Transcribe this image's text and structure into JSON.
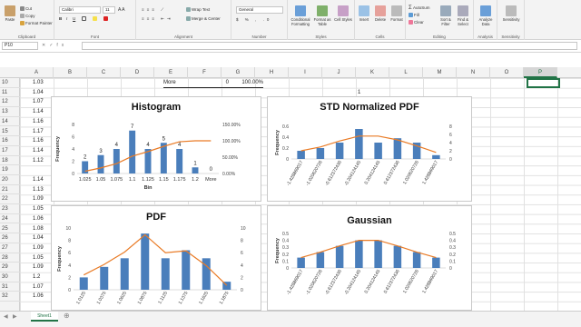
{
  "ribbon": {
    "clipboard": {
      "cut": "Cut",
      "copy": "Copy",
      "format_painter": "Format Painter",
      "paste": "Paste",
      "label": "Clipboard"
    },
    "font": {
      "name": "Calibri",
      "size": "11",
      "label": "Font",
      "bold": "B",
      "italic": "I",
      "underline": "U"
    },
    "alignment": {
      "wrap": "Wrap Text",
      "merge": "Merge & Center",
      "label": "Alignment"
    },
    "number": {
      "format": "General",
      "label": "Number",
      "pct": "%",
      "comma": ","
    },
    "styles": {
      "cond": "Conditional Formatting",
      "table": "Format as Table",
      "cell": "Cell Styles",
      "label": "Styles"
    },
    "cells": {
      "insert": "Insert",
      "delete": "Delete",
      "format": "Format",
      "label": "Cells"
    },
    "editing": {
      "autosum": "AutoSum",
      "fill": "Fill",
      "clear": "Clear",
      "sort": "Sort & Filter",
      "find": "Find & Select",
      "label": "Editing"
    },
    "analysis": {
      "analyze": "Analyze Data",
      "label": "Analysis"
    },
    "sensitivity": {
      "btn": "Sensitivity",
      "label": "Sensitivity"
    }
  },
  "formula_bar": {
    "name_box": "P10",
    "formula": ""
  },
  "columns": [
    "A",
    "B",
    "C",
    "D",
    "E",
    "F",
    "G",
    "H",
    "I",
    "J",
    "K",
    "L",
    "M",
    "N",
    "O",
    "P"
  ],
  "selected_column": "P",
  "rows": [
    "10",
    "11",
    "12",
    "13",
    "14",
    "15",
    "16",
    "17",
    "18",
    "19",
    "20",
    "21",
    "22",
    "23",
    "24",
    "25",
    "26",
    "27",
    "28",
    "29",
    "30",
    "31",
    "32"
  ],
  "col_a_values": [
    "1.03",
    "1.04",
    "1.07",
    "1.14",
    "1.16",
    "1.17",
    "1.16",
    "1.14",
    "1.12",
    "",
    "1.14",
    "1.13",
    "1.09",
    "1.05",
    "1.06",
    "1.08",
    "1.04",
    "1.09",
    "1.05",
    "1.09",
    "1.2",
    "1.07",
    "1.06"
  ],
  "row10": {
    "label": "More",
    "count": "0",
    "pct": "100.00%"
  },
  "j11": "1",
  "charts": {
    "histogram": {
      "title": "Histogram",
      "ylabel": "Frequency",
      "xlabel": "Bin",
      "y2ticks": [
        "150.00%",
        "100.00%",
        "50.00%",
        "0.00%"
      ]
    },
    "std_pdf": {
      "title": "STD Normalized PDF",
      "ylabel": "Frequency"
    },
    "pdf": {
      "title": "PDF",
      "ylabel": "Frequency"
    },
    "gauss": {
      "title": "Gaussian",
      "ylabel": "Frequency"
    }
  },
  "chart_data": [
    {
      "type": "bar",
      "title": "Histogram",
      "categories": [
        "1.025",
        "1.05",
        "1.075",
        "1.1",
        "1.125",
        "1.15",
        "1.175",
        "1.2",
        "More"
      ],
      "series": [
        {
          "values": [
            2,
            3,
            4,
            7,
            4,
            5,
            4,
            1,
            0
          ]
        }
      ],
      "line": {
        "values": [
          0.07,
          0.17,
          0.3,
          0.53,
          0.67,
          0.83,
          0.97,
          1.0,
          1.0
        ]
      },
      "ylim": [
        0,
        8
      ],
      "y2lim": [
        0,
        1.5
      ],
      "xlabel": "Bin",
      "ylabel": "Frequency",
      "data_labels": true
    },
    {
      "type": "bar",
      "title": "STD Normalized PDF",
      "categories": [
        "-1.428869017",
        "-1.020620726",
        "-0.612372436",
        "-0.204124145",
        "0.204124145",
        "0.612372436",
        "1.020620726",
        "1.428869017"
      ],
      "series": [
        {
          "values": [
            0.15,
            0.2,
            0.3,
            0.55,
            0.3,
            0.38,
            0.3,
            0.07
          ]
        }
      ],
      "line": {
        "values": [
          0.15,
          0.22,
          0.33,
          0.42,
          0.42,
          0.35,
          0.24,
          0.12
        ]
      },
      "ylim": [
        0,
        0.6
      ],
      "yticks": [
        "0.6",
        "0.4",
        "0.2",
        "0"
      ],
      "y2ticks": [
        "8",
        "6",
        "4",
        "2",
        "0"
      ],
      "ylabel": "Frequency"
    },
    {
      "type": "bar",
      "title": "PDF",
      "categories": [
        "1.0125",
        "1.0375",
        "1.0625",
        "1.0875",
        "1.1125",
        "1.1375",
        "1.1625",
        "1.1875"
      ],
      "series": [
        {
          "values": [
            2,
            3.7,
            5.1,
            9.1,
            5.1,
            6.4,
            5.1,
            1.3
          ]
        }
      ],
      "line": {
        "values": [
          2.4,
          4.1,
          6.1,
          8.9,
          6.0,
          6.3,
          3.9,
          0.7
        ]
      },
      "ylim": [
        0,
        10
      ],
      "yticks": [
        "10",
        "8",
        "6",
        "4",
        "2",
        "0"
      ],
      "y2ticks": [
        "10",
        "8",
        "6",
        "4",
        "2",
        "0"
      ],
      "ylabel": "Frequency"
    },
    {
      "type": "bar",
      "title": "Gaussian",
      "categories": [
        "-1.428869017",
        "-1.020620726",
        "-0.612372436",
        "-0.204124145",
        "0.204124145",
        "0.612372436",
        "1.020620726",
        "1.428869017"
      ],
      "series": [
        {
          "values": [
            0.15,
            0.23,
            0.32,
            0.4,
            0.4,
            0.32,
            0.23,
            0.15
          ]
        }
      ],
      "line": {
        "values": [
          0.15,
          0.23,
          0.32,
          0.4,
          0.4,
          0.32,
          0.23,
          0.15
        ]
      },
      "ylim": [
        0,
        0.5
      ],
      "yticks": [
        "0.5",
        "0.4",
        "0.3",
        "0.2",
        "0.1",
        "0"
      ],
      "y2ticks": [
        "0.5",
        "0.4",
        "0.3",
        "0.2",
        "0.1",
        "0"
      ],
      "ylabel": "Frequency"
    }
  ],
  "colors": {
    "bar": "#4a7ebb",
    "line": "#e97b26",
    "excel_green": "#217346"
  },
  "sheet_tab": "Sheet1"
}
